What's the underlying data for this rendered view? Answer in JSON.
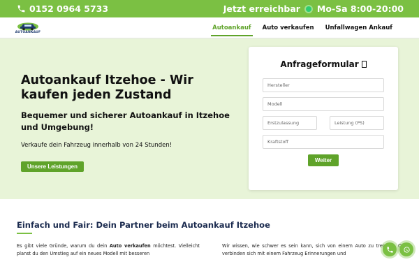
{
  "topbar": {
    "phone": "0152 0964 5733",
    "reachable": "Jetzt erreichbar",
    "hours": "Mo-Sa 8:00-20:00"
  },
  "logo": {
    "text": "AUTOANKAUF"
  },
  "nav": {
    "items": [
      {
        "label": "Autoankauf",
        "active": true
      },
      {
        "label": "Auto verkaufen"
      },
      {
        "label": "Unfallwagen Ankauf"
      }
    ]
  },
  "hero": {
    "title": "Autoankauf Itzehoe - Wir kaufen jeden Zustand",
    "subtitle": "Bequemer und sicherer Autoankauf in Itzehoe und Umgebung!",
    "text": "Verkaufe dein Fahrzeug innerhalb von 24 Stunden!",
    "button": "Unsere Leistungen"
  },
  "form": {
    "title": "Anfrageformular",
    "fields": {
      "manufacturer": "Hersteller",
      "model": "Modell",
      "registration": "Erstzulassung",
      "power": "Leistung (PS)",
      "fuel": "Kraftstoff"
    },
    "submit": "Weiter"
  },
  "section": {
    "title": "Einfach und Fair: Dein Partner beim Autoankauf Itzehoe",
    "left_pre": "Es gibt viele Gründe, warum du dein ",
    "left_bold": "Auto verkaufen",
    "left_post": " möchtest. Vielleicht planst du den Umstieg auf ein neues Modell mit besseren",
    "right": "Wir wissen, wie schwer es sein kann, sich von einem Auto zu trennen. Oft verbinden sich mit einem Fahrzeug Erinnerungen und"
  },
  "colors": {
    "brand_green": "#7bc043",
    "accent_green": "#5fa32a",
    "hero_bg": "#e8f4d8",
    "heading_navy": "#1b2b4f"
  },
  "icons": [
    "phone-icon",
    "online-dot-icon",
    "car-logo-icon",
    "phone-fab-icon",
    "whatsapp-icon"
  ]
}
